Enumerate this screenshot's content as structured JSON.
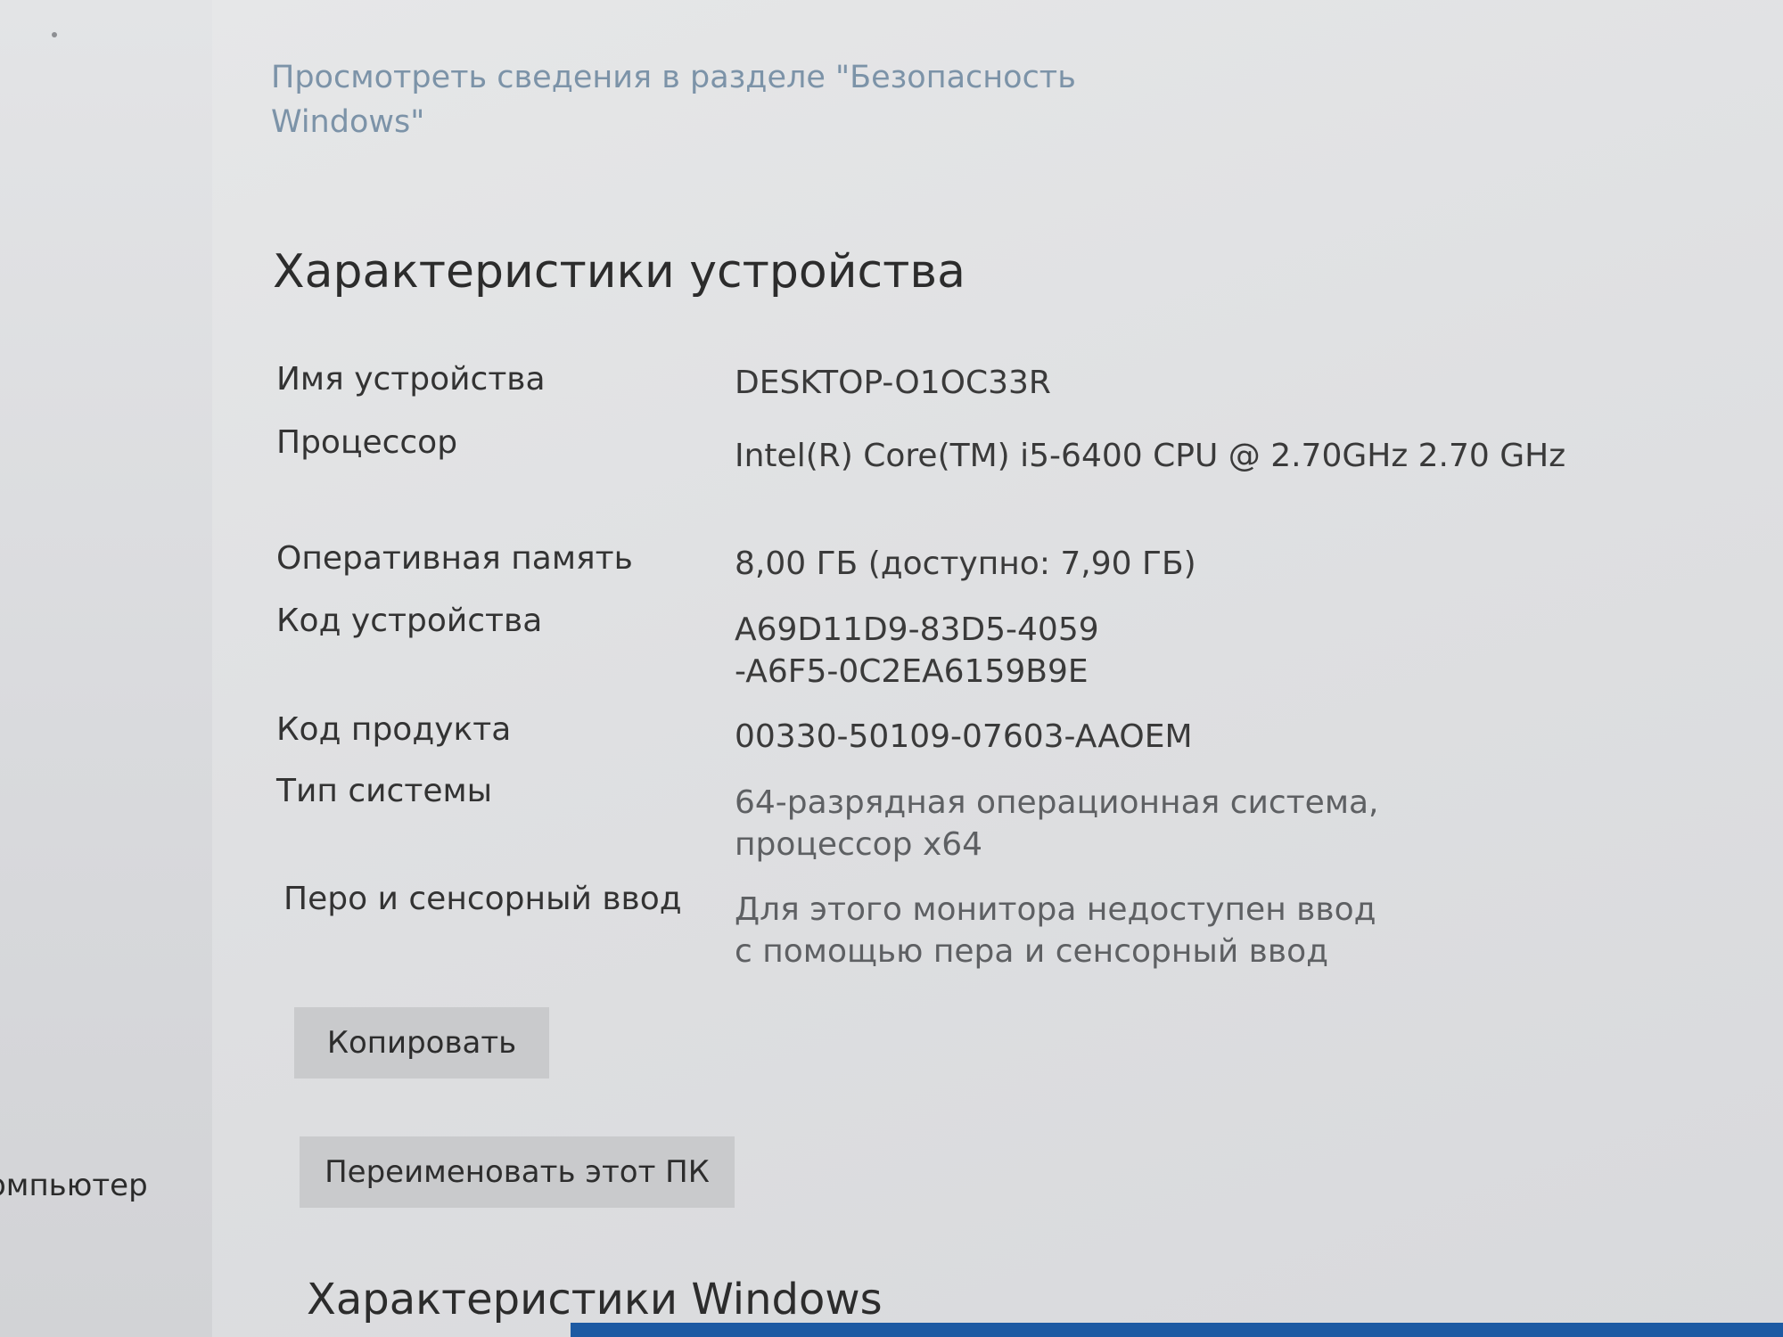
{
  "sidebar": {
    "partial_item_label": "омпьютер"
  },
  "main": {
    "security_link": "Просмотреть сведения в разделе \"Безопасность Windows\"",
    "device_specs": {
      "title": "Характеристики устройства",
      "rows": [
        {
          "label": "Имя устройства",
          "value": "DESKTOP-O1OC33R"
        },
        {
          "label": "Процессор",
          "value": "Intel(R) Core(TM) i5-6400 CPU @ 2.70GHz 2.70 GHz"
        },
        {
          "label": "Оперативная память",
          "value": "8,00 ГБ (доступно: 7,90 ГБ)"
        },
        {
          "label": "Код устройства",
          "value": "A69D11D9-83D5-4059-A6F5-0C2EA6159B9E"
        },
        {
          "label": "Код продукта",
          "value": "00330-50109-07603-AAOEM"
        },
        {
          "label": "Тип системы",
          "value": "64-разрядная операционная система, процессор x64"
        },
        {
          "label": "Перо и сенсорный ввод",
          "value": "Для этого монитора недоступен ввод с помощью пера и сенсорный ввод"
        }
      ]
    },
    "copy_button": "Копировать",
    "rename_button": "Переименовать этот ПК",
    "windows_specs_title": "Характеристики Windows"
  }
}
